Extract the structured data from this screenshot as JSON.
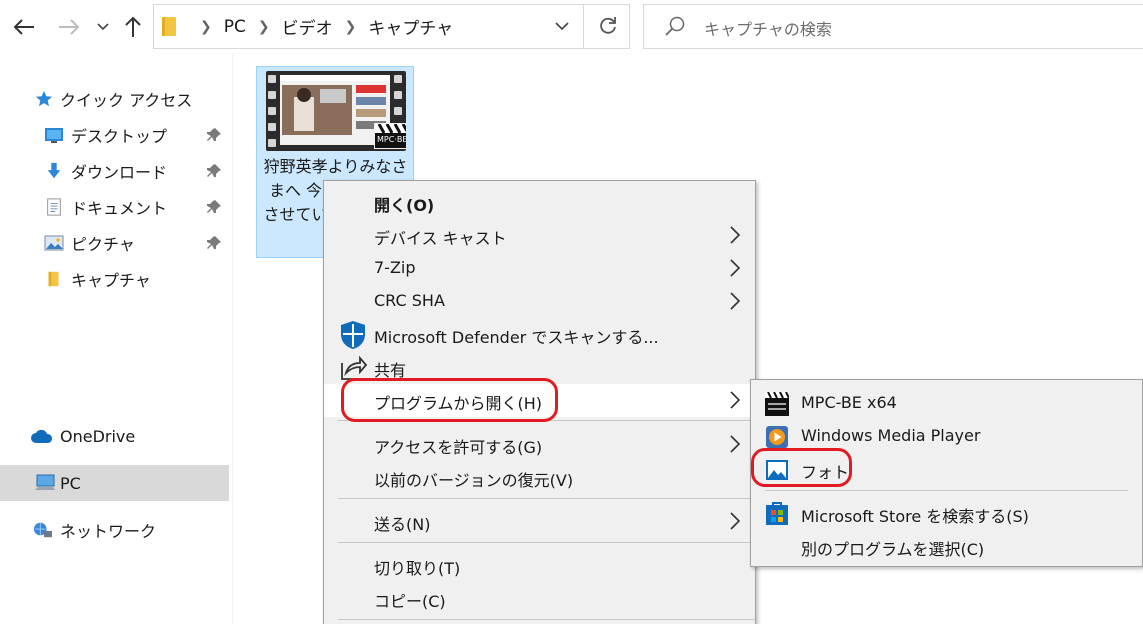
{
  "address_bar": {
    "breadcrumbs": [
      "PC",
      "ビデオ",
      "キャプチャ"
    ]
  },
  "search": {
    "placeholder": "キャプチャの検索"
  },
  "nav": {
    "quick_access": "クイック アクセス",
    "pinned": [
      {
        "label": "デスクトップ",
        "icon": "desktop-icon"
      },
      {
        "label": "ダウンロード",
        "icon": "download-icon"
      },
      {
        "label": "ドキュメント",
        "icon": "documents-icon"
      },
      {
        "label": "ピクチャ",
        "icon": "pictures-icon"
      }
    ],
    "capture_folder": "キャプチャ",
    "onedrive": "OneDrive",
    "pc": "PC",
    "network": "ネットワーク"
  },
  "file": {
    "name": "狩野英孝よりみなさまへ 今日はお話しさせていただきます -",
    "badge": "MPC·BE"
  },
  "context_menu": {
    "open": "開く(O)",
    "cast": "デバイス キャスト",
    "zip": "7-Zip",
    "crc": "CRC SHA",
    "defender": "Microsoft Defender でスキャンする...",
    "share": "共有",
    "open_with": "プログラムから開く(H)",
    "give_access": "アクセスを許可する(G)",
    "restore": "以前のバージョンの復元(V)",
    "send_to": "送る(N)",
    "cut": "切り取り(T)",
    "copy": "コピー(C)"
  },
  "submenu": {
    "mpc": "MPC-BE x64",
    "wmp": "Windows Media Player",
    "photos": "フォト",
    "store": "Microsoft Store を検索する(S)",
    "choose": "別のプログラムを選択(C)"
  },
  "colors": {
    "highlight_oval": "#e01b24",
    "selection": "#cce8ff",
    "menu_bg": "#f0f0f0"
  }
}
